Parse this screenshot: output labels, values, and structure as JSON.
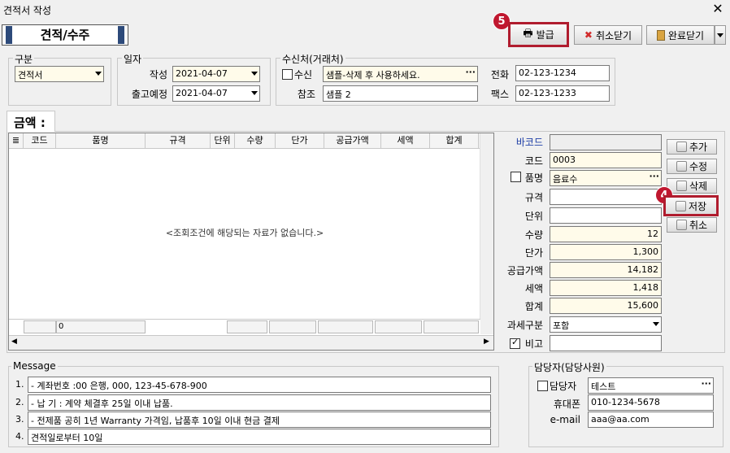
{
  "window": {
    "title": "견적서 작성",
    "close": "✕"
  },
  "page_title": "견적/수주",
  "toolbar": {
    "issue_label": "발급",
    "issue_badge": "5",
    "cancel_close_label": "취소닫기",
    "done_close_label": "완료닫기"
  },
  "category": {
    "group_label": "구분",
    "value": "견적서"
  },
  "date": {
    "group_label": "일자",
    "written_label": "작성",
    "written_value": "2021-04-07",
    "ship_label": "출고예정",
    "ship_value": "2021-04-07"
  },
  "recipient": {
    "group_label": "수신처(거래처)",
    "receive_label": "수신",
    "receive_value": "샘플-삭제 후 사용하세요.",
    "ref_label": "참조",
    "ref_value": "샘플 2",
    "phone_label": "전화",
    "phone_value": "02-123-1234",
    "fax_label": "팩스",
    "fax_value": "02-123-1233",
    "ellipsis": "···"
  },
  "amount_tab": "금액 :",
  "grid": {
    "columns": [
      "코드",
      "품명",
      "규격",
      "단위",
      "수량",
      "단가",
      "공급가액",
      "세액",
      "합계"
    ],
    "empty_message": "<조회조건에 해당되는 자료가 없습니다.>",
    "footer_count": "0"
  },
  "item_form": {
    "barcode_label": "바코드",
    "barcode_value": "",
    "code_label": "코드",
    "code_value": "0003",
    "name_label": "품명",
    "name_value": "음료수",
    "spec_label": "규격",
    "spec_value": "",
    "unit_label": "단위",
    "unit_value": "",
    "qty_label": "수량",
    "qty_value": "12",
    "price_label": "단가",
    "price_value": "1,300",
    "supply_label": "공급가액",
    "supply_value": "14,182",
    "tax_label": "세액",
    "tax_value": "1,418",
    "total_label": "합계",
    "total_value": "15,600",
    "taxtype_label": "과세구분",
    "taxtype_value": "포함",
    "note_label": "비고",
    "note_value": ""
  },
  "side_buttons": {
    "add": "추가",
    "edit": "수정",
    "delete": "삭제",
    "save": "저장",
    "cancel": "취소",
    "save_badge": "4"
  },
  "message": {
    "group_label": "Message",
    "lines": [
      {
        "num": "1.",
        "text": "- 계좌번호 :00 은행, 000, 123-45-678-900"
      },
      {
        "num": "2.",
        "text": "- 납 기 : 계약 체결후 25일 이내 납품."
      },
      {
        "num": "3.",
        "text": "- 전제품 공히 1년 Warranty 가격임, 납품후 10일 이내 현금 결제"
      },
      {
        "num": "4.",
        "text": "견적일로부터 10일"
      }
    ]
  },
  "manager": {
    "group_label": "담당자(담당사원)",
    "name_label": "담당자",
    "name_value": "테스트",
    "mobile_label": "휴대폰",
    "mobile_value": "010-1234-5678",
    "email_label": "e-mail",
    "email_value": "aaa@aa.com"
  },
  "colors": {
    "badge": "#c0172f",
    "highlight": "#b01c2e",
    "title_bar": "#2d4a7a",
    "field_yellow": "#fffbea"
  }
}
